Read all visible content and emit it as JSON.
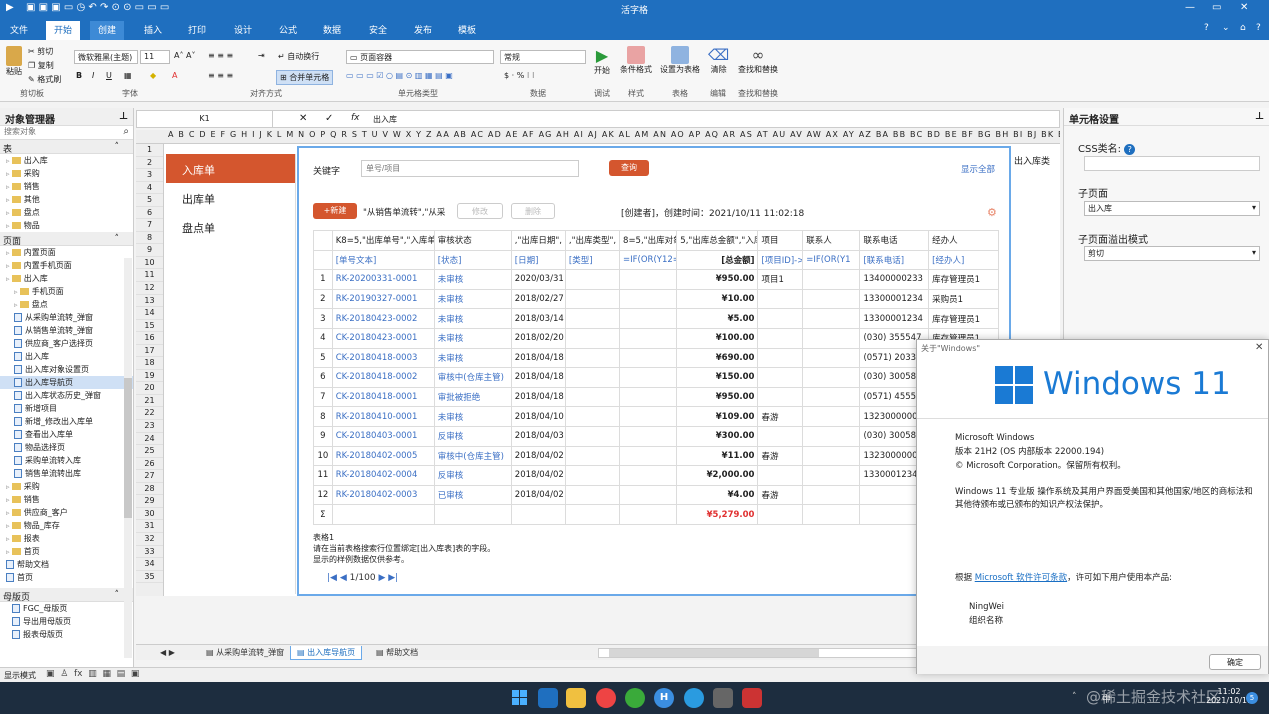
{
  "window": {
    "title": "活字格"
  },
  "menu": {
    "items": [
      "文件",
      "开始",
      "创建",
      "插入",
      "打印",
      "设计",
      "公式",
      "数据",
      "安全",
      "发布",
      "模板"
    ],
    "active": "开始",
    "highlight": "创建"
  },
  "ribbon": {
    "paste": "粘贴",
    "cut": "剪切",
    "copy": "复制",
    "format_painter": "格式刷",
    "font_name": "微软雅黑(主题)",
    "font_size": "11",
    "wrap": "自动换行",
    "merge": "合并单元格",
    "cell_type": "页面容器",
    "number_format": "常规",
    "start": "开始",
    "cond_format": "条件格式",
    "set_table": "设置为表格",
    "clear": "清除",
    "find": "查找和替换",
    "groups": {
      "clipboard": "剪切板",
      "font": "字体",
      "align": "对齐方式",
      "cell_type": "单元格类型",
      "number": "数据",
      "debug": "调试",
      "style": "样式",
      "table": "表格",
      "edit": "编辑",
      "findrep": "查找和替换"
    }
  },
  "object_manager": {
    "title": "对象管理器",
    "search_placeholder": "搜索对象",
    "section_tables": "表",
    "tables": [
      "出入库",
      "采购",
      "销售",
      "其他",
      "盘点",
      "物品"
    ],
    "section_pages": "页面",
    "pages": [
      {
        "label": "内置页面",
        "type": "folder",
        "indent": 1
      },
      {
        "label": "内置手机页面",
        "type": "folder",
        "indent": 1
      },
      {
        "label": "出入库",
        "type": "folder",
        "indent": 1
      },
      {
        "label": "手机页面",
        "type": "folder",
        "indent": 2
      },
      {
        "label": "盘点",
        "type": "folder",
        "indent": 2
      },
      {
        "label": "从采购单流转_弹窗",
        "type": "page",
        "indent": 2
      },
      {
        "label": "从销售单流转_弹窗",
        "type": "page",
        "indent": 2
      },
      {
        "label": "供应商_客户选择页",
        "type": "page",
        "indent": 2
      },
      {
        "label": "出入库",
        "type": "page",
        "indent": 2
      },
      {
        "label": "出入库对象设置页",
        "type": "page",
        "indent": 2
      },
      {
        "label": "出入库导航页",
        "type": "page",
        "indent": 2,
        "selected": true
      },
      {
        "label": "出入库状态历史_弹窗",
        "type": "page",
        "indent": 2
      },
      {
        "label": "新增项目",
        "type": "page",
        "indent": 2
      },
      {
        "label": "新增_修改出入库单",
        "type": "page",
        "indent": 2
      },
      {
        "label": "查看出入库单",
        "type": "page",
        "indent": 2
      },
      {
        "label": "物品选择页",
        "type": "page",
        "indent": 2
      },
      {
        "label": "采购单流转入库",
        "type": "page",
        "indent": 2
      },
      {
        "label": "销售单流转出库",
        "type": "page",
        "indent": 2
      },
      {
        "label": "采购",
        "type": "folder",
        "indent": 1
      },
      {
        "label": "销售",
        "type": "folder",
        "indent": 1
      },
      {
        "label": "供应商_客户",
        "type": "folder",
        "indent": 1
      },
      {
        "label": "物品_库存",
        "type": "folder",
        "indent": 1
      },
      {
        "label": "报表",
        "type": "folder",
        "indent": 1
      },
      {
        "label": "首页",
        "type": "folder",
        "indent": 1
      },
      {
        "label": "帮助文档",
        "type": "page",
        "indent": 1
      },
      {
        "label": "首页",
        "type": "page",
        "indent": 1
      }
    ],
    "section_master": "母版页",
    "masters": [
      "FGC_母版页",
      "导出用母版页",
      "报表母版页"
    ]
  },
  "formula": {
    "cellref": "K1",
    "value": "出入库"
  },
  "columns": "A B C D E F G H I J K L M N O P Q R S T U V W X Y Z AA AB AC AD AE AF AG AH AI AJ AK AL AM AN AO AP AQ AR AS AT AU AV AW AX AY AZ BA BB BC BD BE BF BG BH BI BJ BK BL",
  "rows": [
    "1",
    "2",
    "3",
    "4",
    "5",
    "6",
    "7",
    "8",
    "9",
    "10",
    "11",
    "12",
    "13",
    "14",
    "15",
    "16",
    "17",
    "18",
    "19",
    "20",
    "21",
    "22",
    "23",
    "24",
    "25",
    "26",
    "27",
    "28",
    "29",
    "30",
    "31",
    "32",
    "33",
    "34",
    "35"
  ],
  "nav": {
    "items": [
      "入库单",
      "出库单",
      "盘点单"
    ],
    "active": "入库单"
  },
  "page": {
    "keyword_label": "关键字",
    "keyword_placeholder": "单号/项目",
    "search_btn": "查询",
    "show_all": "显示全部",
    "new_btn": "+新建",
    "flow_text": "\"从销售单流转\",\"从采",
    "edit_btn": "修改",
    "delete_btn": "删除",
    "creator_text": "[创建者]，创建时间：2021/10/11 11:02:18",
    "headers": [
      "K8=5,\"出库单号\",\"入库单",
      "审核状态",
      ",\"出库日期\",",
      ",\"出库类型\",",
      "8=5,\"出库对象\",\"入",
      "5,\"出库总金额\",\"入库",
      "项目",
      "联系人",
      "联系电话",
      "经办人"
    ],
    "subheaders": [
      "[单号文本]",
      "[状态]",
      "[日期]",
      "[类型]",
      "=IF(OR(Y12=1,Y12",
      "[总金额]",
      "[项目ID]->[",
      "=IF(OR(Y1",
      "[联系电话]",
      "[经办人]"
    ],
    "rows": [
      {
        "n": "1",
        "no": "RK-20200331-0001",
        "status": "未审核",
        "date": "2020/03/31",
        "amt": "¥950.00",
        "proj": "项目1",
        "phone": "13400000233",
        "agent": "库存管理员1"
      },
      {
        "n": "2",
        "no": "RK-20190327-0001",
        "status": "未审核",
        "date": "2018/02/27",
        "amt": "¥10.00",
        "proj": "",
        "phone": "13300001234",
        "agent": "采购员1"
      },
      {
        "n": "3",
        "no": "RK-20180423-0002",
        "status": "未审核",
        "date": "2018/03/14",
        "amt": "¥5.00",
        "proj": "",
        "phone": "13300001234",
        "agent": "库存管理员1"
      },
      {
        "n": "4",
        "no": "CK-20180423-0001",
        "status": "未审核",
        "date": "2018/02/20",
        "amt": "¥100.00",
        "proj": "",
        "phone": "(030) 355547",
        "agent": "库存管理员1"
      },
      {
        "n": "5",
        "no": "CK-20180418-0003",
        "status": "未审核",
        "date": "2018/04/18",
        "amt": "¥690.00",
        "proj": "",
        "phone": "(0571) 2033",
        "agent": ""
      },
      {
        "n": "6",
        "no": "CK-20180418-0002",
        "status": "审核中(仓库主管)",
        "date": "2018/04/18",
        "amt": "¥150.00",
        "proj": "",
        "phone": "(030) 30058",
        "agent": ""
      },
      {
        "n": "7",
        "no": "CK-20180418-0001",
        "status": "审批被拒绝",
        "date": "2018/04/18",
        "amt": "¥950.00",
        "proj": "",
        "phone": "(0571) 4555",
        "agent": ""
      },
      {
        "n": "8",
        "no": "RK-20180410-0001",
        "status": "未审核",
        "date": "2018/04/10",
        "amt": "¥109.00",
        "proj": "春游",
        "phone": "1323000000",
        "agent": ""
      },
      {
        "n": "9",
        "no": "CK-20180403-0001",
        "status": "反审核",
        "date": "2018/04/03",
        "amt": "¥300.00",
        "proj": "",
        "phone": "(030) 30058",
        "agent": ""
      },
      {
        "n": "10",
        "no": "RK-20180402-0005",
        "status": "审核中(仓库主管)",
        "date": "2018/04/02",
        "amt": "¥11.00",
        "proj": "春游",
        "phone": "1323000000",
        "agent": ""
      },
      {
        "n": "11",
        "no": "RK-20180402-0004",
        "status": "反审核",
        "date": "2018/04/02",
        "amt": "¥2,000.00",
        "proj": "",
        "phone": "1330001234",
        "agent": ""
      },
      {
        "n": "12",
        "no": "RK-20180402-0003",
        "status": "已审核",
        "date": "2018/04/02",
        "amt": "¥4.00",
        "proj": "春游",
        "phone": "",
        "agent": ""
      }
    ],
    "sum_label": "Σ",
    "sum_value": "¥5,279.00",
    "note1": "表格1",
    "note2": "请在当前表格搜索行位置绑定[出入库表]表的字段。",
    "note3": "显示的样例数据仅供参考。",
    "pager": "1/100"
  },
  "sheet_tabs": [
    "从采购单流转_弹窗",
    "出入库导航页",
    "帮助文档"
  ],
  "sheet_tab_active": "出入库导航页",
  "side_hint": "出入库类",
  "cell_settings": {
    "title": "单元格设置",
    "css_label": "CSS类名:",
    "subpage_label": "子页面",
    "subpage_value": "出入库",
    "overflow_label": "子页面溢出模式",
    "overflow_value": "剪切"
  },
  "status": {
    "mode": "显示模式"
  },
  "dialog": {
    "title": "关于\"Windows\"",
    "logo": "Windows 11",
    "line1": "Microsoft Windows",
    "line2": "版本 21H2 (OS 内部版本 22000.194)",
    "line3": "© Microsoft Corporation。保留所有权利。",
    "para": "Windows 11 专业版 操作系统及其用户界面受美国和其他国家/地区的商标法和其他待颁布或已颁布的知识产权法保护。",
    "license_pre": "根据 ",
    "license_link": "Microsoft 软件许可条款",
    "license_post": "，许可如下用户使用本产品:",
    "user": "NingWei",
    "org": "组织名称",
    "ok": "确定"
  },
  "taskbar": {
    "time": "11:02",
    "date": "2021/10/11",
    "lang": "中",
    "watermark": "@稀土掘金技术社区",
    "badge": "5"
  },
  "colors": {
    "brand": "#1f6fbf",
    "accent": "#d4562e",
    "link": "#3b6fc4",
    "red": "#e03030"
  }
}
